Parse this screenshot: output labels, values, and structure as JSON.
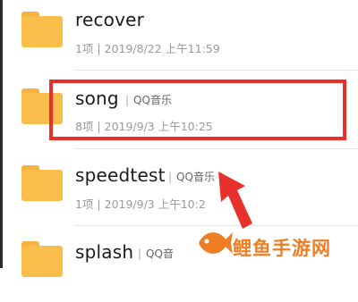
{
  "folders": [
    {
      "name": "recover",
      "tag": "",
      "meta": "1项 | 2019/8/22 上午11:59"
    },
    {
      "name": "song",
      "tag": "QQ音乐",
      "meta": "8项 | 2019/9/3 上午10:25"
    },
    {
      "name": "speedtest",
      "tag": "QQ音乐",
      "meta": "1项 | 2019/9/3 上午10:2"
    },
    {
      "name": "splash",
      "tag": "QQ音",
      "meta": ""
    }
  ],
  "annotation": {
    "highlighted_folder": "song",
    "color": "#e8302c"
  },
  "watermark": {
    "text": "鲤鱼手游网",
    "color": "#ef7d24"
  },
  "colors": {
    "folder": "#f9bd4b",
    "name": "#1b1b1b",
    "meta": "#9a9a9a"
  }
}
